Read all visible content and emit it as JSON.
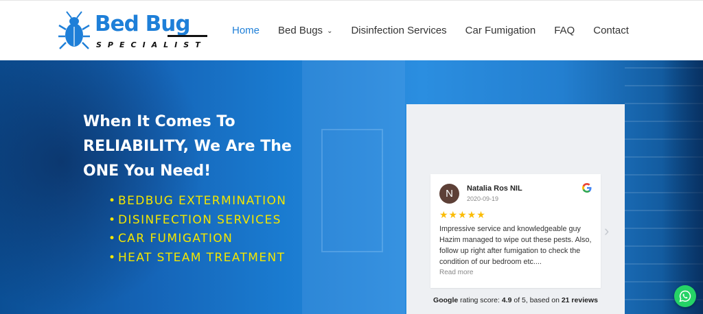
{
  "brand": {
    "title_bed": "Bed",
    "title_bug": "Bug",
    "subtitle": "SPECIALIST",
    "logo_color": "#1e7fd8"
  },
  "nav": {
    "items": [
      {
        "label": "Home",
        "active": true
      },
      {
        "label": "Bed Bugs",
        "has_dropdown": true
      },
      {
        "label": "Disinfection Services"
      },
      {
        "label": "Car Fumigation"
      },
      {
        "label": "FAQ"
      },
      {
        "label": "Contact"
      }
    ],
    "accent": "#1e7fd8"
  },
  "hero": {
    "headline_line1": "When It Comes To",
    "headline_line2": "RELIABILITY, We Are The",
    "headline_line3": "ONE You Need!",
    "services": [
      "BEDBUG EXTERMINATION",
      "DISINFECTION SERVICES",
      "CAR FUMIGATION",
      "HEAT STEAM TREATMENT"
    ],
    "bullet": "•",
    "service_color": "#f3e600"
  },
  "review": {
    "avatar_letter": "N",
    "name": "Natalia Ros NIL",
    "date": "2020-09-19",
    "stars": "★★★★★",
    "text": "Impressive service and knowledgeable guy Hazim managed to wipe out these pests. Also, follow up right after fumigation to check the condition of our bedroom etc....",
    "read_more": "Read more",
    "next_icon": "chevron-right-icon",
    "summary": {
      "prefix": "Google",
      "mid1": " rating score: ",
      "score": "4.9",
      "mid2": " of 5, based on ",
      "count": "21 reviews"
    }
  },
  "whatsapp": {
    "icon": "whatsapp-icon",
    "color": "#25d366"
  }
}
